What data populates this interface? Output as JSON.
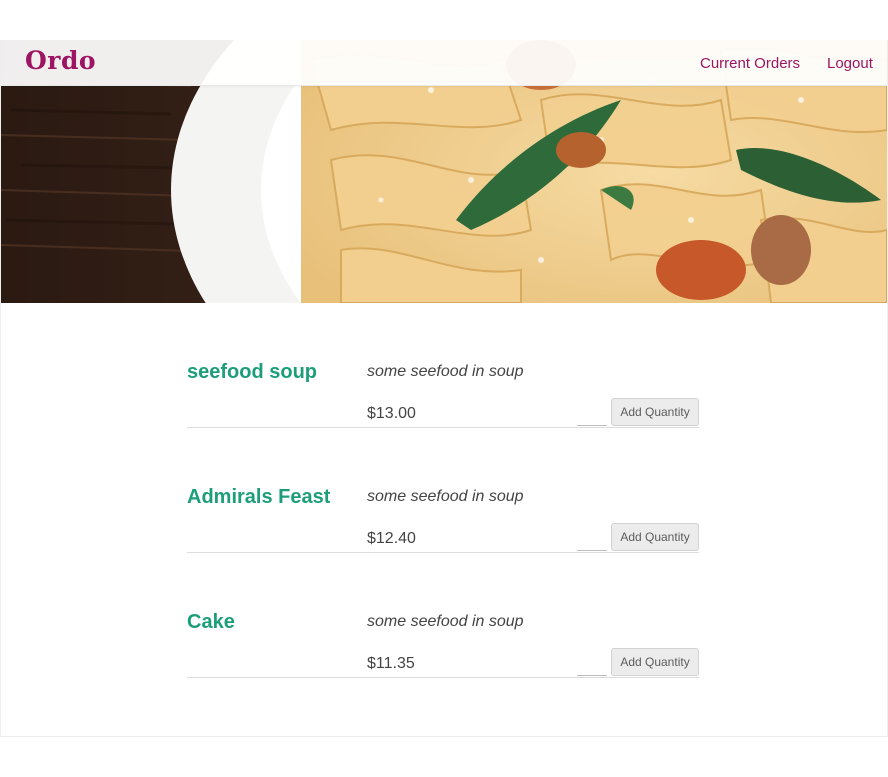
{
  "app": {
    "brand": "Ordo"
  },
  "nav": {
    "current_orders": "Current Orders",
    "logout": "Logout"
  },
  "colors": {
    "brand": "#9c1462",
    "item_name": "#1d9e7a",
    "divider": "#dcdcdc"
  },
  "menu": {
    "items": [
      {
        "name": "seefood soup",
        "description": "some seefood in soup",
        "price": "$13.00",
        "quantity": "",
        "button": "Add Quantity"
      },
      {
        "name": "Admirals Feast",
        "description": "some seefood in soup",
        "price": "$12.40",
        "quantity": "",
        "button": "Add Quantity"
      },
      {
        "name": "Cake",
        "description": "some seefood in soup",
        "price": "$11.35",
        "quantity": "",
        "button": "Add Quantity"
      }
    ]
  }
}
